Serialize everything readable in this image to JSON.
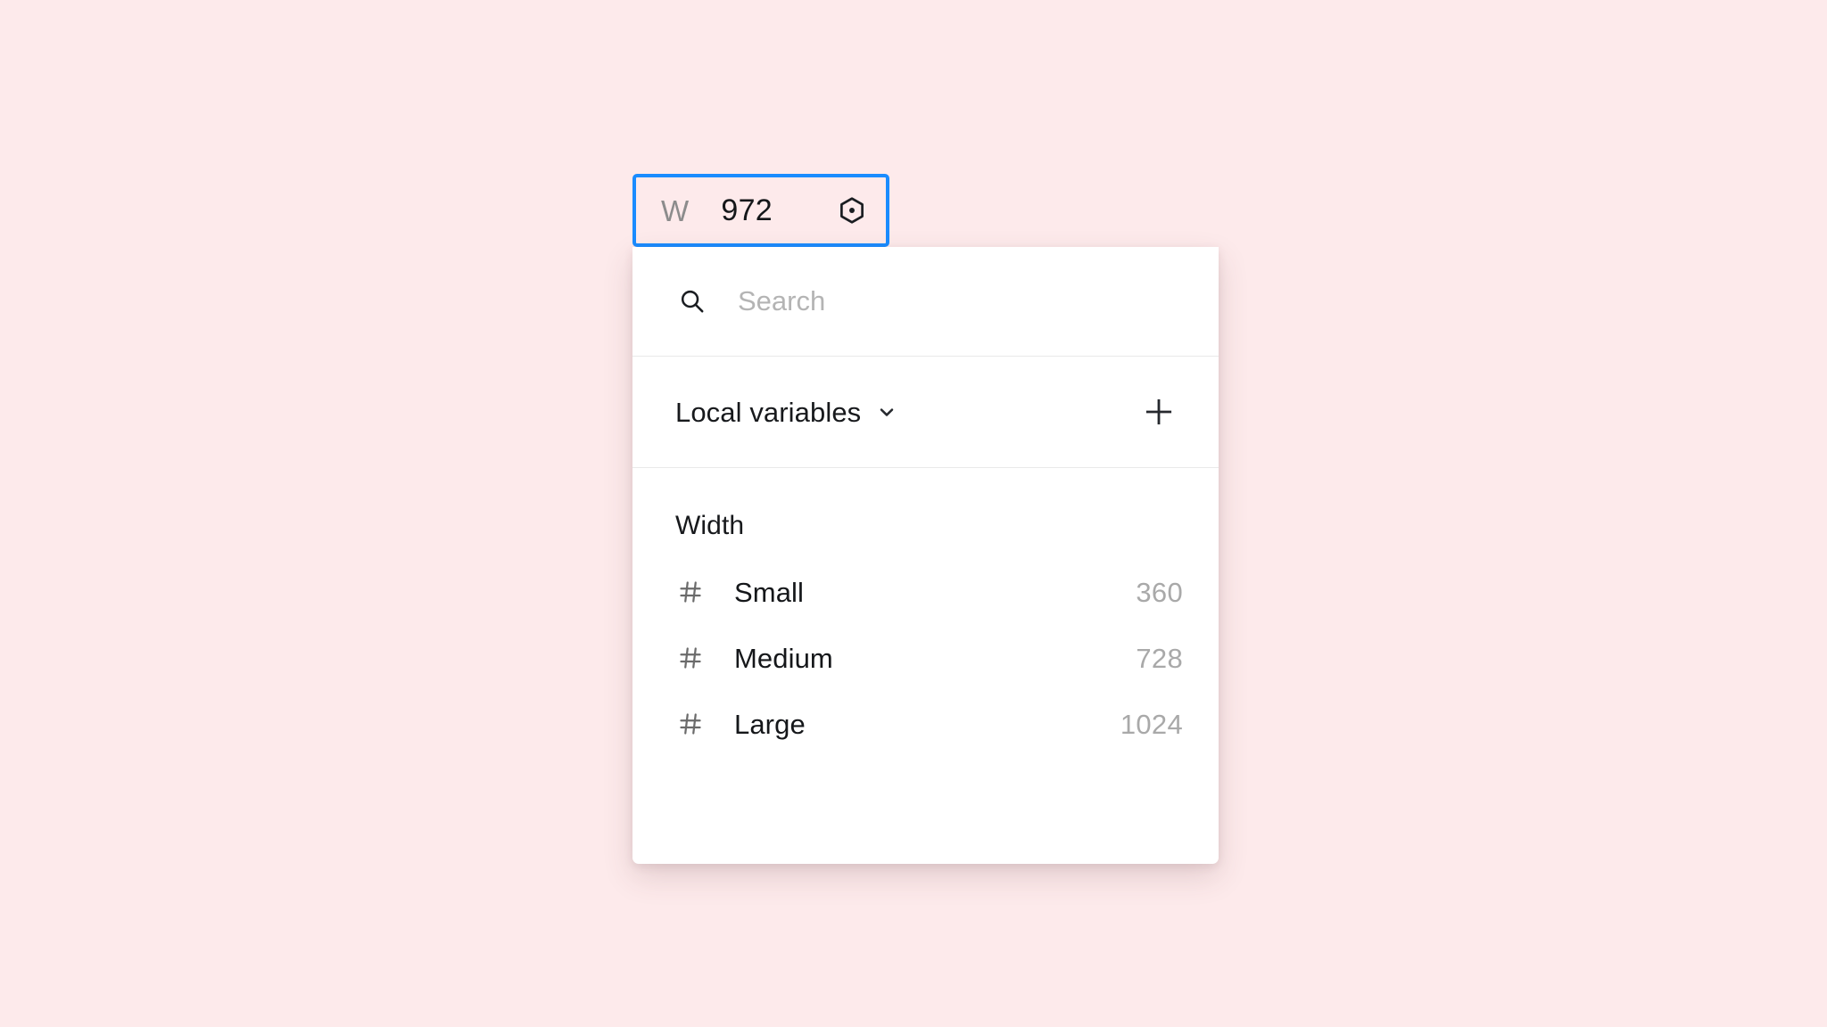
{
  "theme": {
    "background": "#fdeaeb",
    "panel_background": "#ffffff",
    "focus_border": "#1a8cff",
    "divider": "#e9e9e9",
    "text_primary": "#15171a",
    "text_muted": "#8c8c8c",
    "value_muted": "#a9a9a9",
    "placeholder": "#b4b4b4"
  },
  "width_field": {
    "label": "W",
    "value": "972",
    "token_icon": "hexagon-variable-icon",
    "focused": true
  },
  "panel": {
    "search": {
      "icon": "search-icon",
      "placeholder": "Search",
      "value": ""
    },
    "collection": {
      "title": "Local variables",
      "chevron_icon": "chevron-down-icon",
      "add_icon": "plus-icon"
    },
    "groups": [
      {
        "label": "Width",
        "variables": [
          {
            "icon": "hash-icon",
            "name": "Small",
            "value": "360"
          },
          {
            "icon": "hash-icon",
            "name": "Medium",
            "value": "728"
          },
          {
            "icon": "hash-icon",
            "name": "Large",
            "value": "1024"
          }
        ]
      }
    ]
  }
}
